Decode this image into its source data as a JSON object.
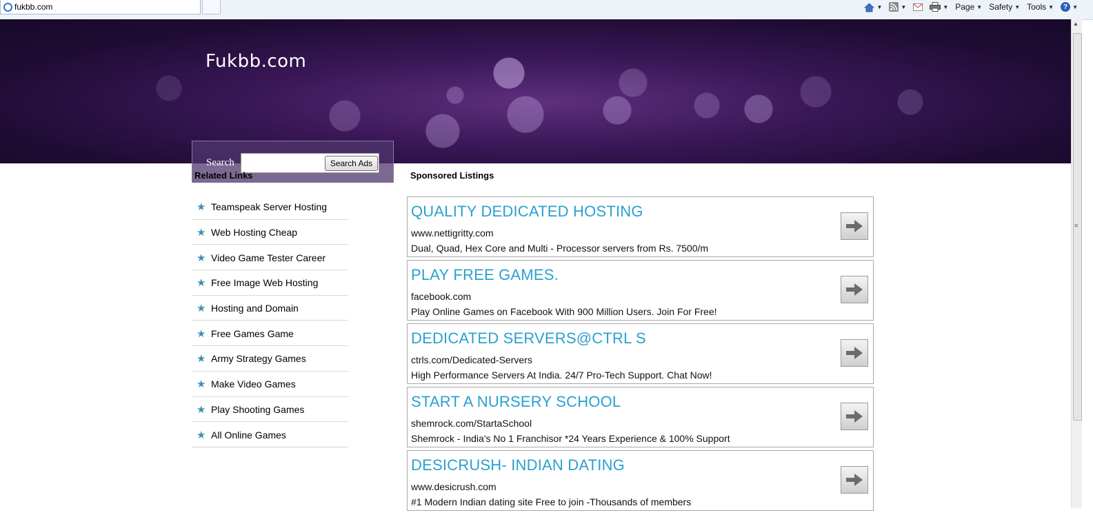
{
  "browser": {
    "tab_title": "fukbb.com",
    "toolbar": {
      "page_label": "Page",
      "safety_label": "Safety",
      "tools_label": "Tools"
    }
  },
  "header": {
    "site_title": "Fukbb.com",
    "search_label": "Search",
    "search_value": "",
    "search_button": "Search Ads"
  },
  "related": {
    "title": "Related Links",
    "items": [
      "Teamspeak Server Hosting",
      "Web Hosting Cheap",
      "Video Game Tester Career",
      "Free Image Web Hosting",
      "Hosting and Domain",
      "Free Games Game",
      "Army Strategy Games",
      "Make Video Games",
      "Play Shooting Games",
      "All Online Games"
    ]
  },
  "sponsored": {
    "title": "Sponsored Listings",
    "ads": [
      {
        "title": "QUALITY DEDICATED HOSTING",
        "url": "www.nettigritty.com",
        "desc": "Dual, Quad, Hex Core and Multi - Processor servers from Rs. 7500/m"
      },
      {
        "title": "PLAY FREE GAMES.",
        "url": "facebook.com",
        "desc": "Play Online Games on Facebook With 900 Million Users. Join For Free!"
      },
      {
        "title": "DEDICATED SERVERS@CTRL S",
        "url": "ctrls.com/Dedicated-Servers",
        "desc": "High Performance Servers At India. 24/7 Pro-Tech Support. Chat Now!"
      },
      {
        "title": "START A NURSERY SCHOOL",
        "url": "shemrock.com/StartaSchool",
        "desc": "Shemrock - India's No 1 Franchisor *24 Years Experience & 100% Support"
      },
      {
        "title": "DESICRUSH- INDIAN DATING",
        "url": "www.desicrush.com",
        "desc": "#1 Modern Indian dating site Free to join -Thousands of members"
      }
    ]
  },
  "colors": {
    "ad_title": "#2aa0cf",
    "star": "#3b90b8",
    "header_dark": "#1e0c33"
  }
}
